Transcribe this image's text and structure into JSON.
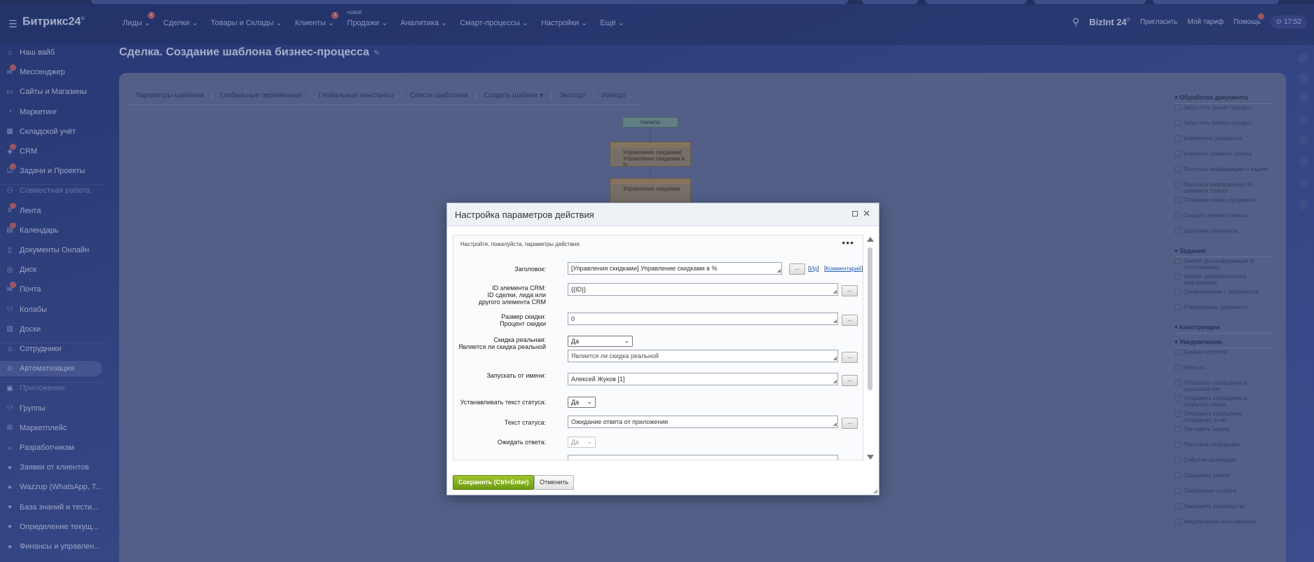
{
  "header": {
    "logo": "Битрикс24",
    "logo_sup": "®",
    "nav": [
      {
        "label": "Лиды",
        "badge": "1"
      },
      {
        "label": "Сделки",
        "badge": ""
      },
      {
        "label": "Товары и Склады",
        "badge": ""
      },
      {
        "label": "Клиенты",
        "badge": "1"
      },
      {
        "label": "Продажи",
        "badge": "",
        "tag": "НОВОЕ"
      },
      {
        "label": "Аналитика",
        "badge": ""
      },
      {
        "label": "Смарт-процессы",
        "badge": ""
      },
      {
        "label": "Настройки",
        "badge": ""
      },
      {
        "label": "Ещё",
        "badge": ""
      }
    ],
    "brand": "BizInt 24",
    "brand_sup": "®",
    "invite": "Пригласить",
    "tariff": "Мой тариф",
    "help": "Помощь",
    "time": "17:52"
  },
  "sidebar": {
    "items": [
      {
        "label": "Наш вайб",
        "icon": "home-icon",
        "badge": false
      },
      {
        "label": "Мессенджер",
        "icon": "chat-icon",
        "badge": true
      },
      {
        "label": "Сайты и Магазины",
        "icon": "site-icon",
        "badge": false
      },
      {
        "label": "Маркетинг",
        "icon": "marketing-icon",
        "badge": false
      },
      {
        "label": "Складской учёт",
        "icon": "warehouse-icon",
        "badge": false
      },
      {
        "label": "CRM",
        "icon": "crm-icon",
        "badge": true
      },
      {
        "label": "Задачи и Проекты",
        "icon": "tasks-icon",
        "badge": true
      },
      {
        "label": "Совместная работа",
        "icon": "collab-icon",
        "badge": false
      },
      {
        "label": "Лента",
        "icon": "feed-icon",
        "badge": true
      },
      {
        "label": "Календарь",
        "icon": "calendar-icon",
        "badge": true
      },
      {
        "label": "Документы Онлайн",
        "icon": "docs-icon",
        "badge": false
      },
      {
        "label": "Диск",
        "icon": "disk-icon",
        "badge": false
      },
      {
        "label": "Почта",
        "icon": "mail-icon",
        "badge": true
      },
      {
        "label": "Колабы",
        "icon": "collabs-icon",
        "badge": false
      },
      {
        "label": "Доски",
        "icon": "boards-icon",
        "badge": false
      },
      {
        "label": "Сотрудники",
        "icon": "employees-icon",
        "badge": false
      },
      {
        "label": "Автоматизация",
        "icon": "automation-icon",
        "badge": false
      },
      {
        "label": "Приложения",
        "icon": "apps-icon",
        "badge": false
      },
      {
        "label": "Группы",
        "icon": "groups-icon",
        "badge": false
      },
      {
        "label": "Маркетплейс",
        "icon": "market-icon",
        "badge": false
      },
      {
        "label": "Разработчикам",
        "icon": "dev-icon",
        "badge": false
      },
      {
        "label": "Заявки от клиентов",
        "icon": "app-icon",
        "badge": false
      },
      {
        "label": "Wazzup (WhatsApp, T...",
        "icon": "app-icon",
        "badge": false
      },
      {
        "label": "База знаний и тести...",
        "icon": "app-icon",
        "badge": false
      },
      {
        "label": "Определение текущ...",
        "icon": "app-icon",
        "badge": false
      },
      {
        "label": "Финансы и управлен...",
        "icon": "app-icon",
        "badge": false
      }
    ]
  },
  "page": {
    "title": "Сделка. Создание шаблона бизнес-процесса",
    "tabs": [
      "Параметры шаблона",
      "Глобальные переменные",
      "Глобальные константы",
      "Список шаблонов",
      "Создать шаблон ▾",
      "Экспорт",
      "Импорт"
    ],
    "workflow": {
      "start": "Начало",
      "box1": "Управление скидками] Управление скидками в %",
      "box2": "Управление скидками"
    }
  },
  "activities": {
    "sections": [
      {
        "title": "Обработка документа",
        "items": [
          "Запустить только процесс",
          "Запустить бизнес-процесс",
          "Изменение документа",
          "Изменить элемент списка",
          "Получить информацию о задаче",
          "Получить информацию об элементе списка",
          "Создание нового документа",
          "Создать элемент списка",
          "Удаление документа"
        ]
      },
      {
        "title": "Задания",
        "items": [
          "Запрос доп.информации (с отклонением)",
          "Запрос дополнительной информации",
          "Ознакомление с документом",
          "Утверждение документа"
        ]
      },
      {
        "title": "Конструкции",
        "items": []
      },
      {
        "title": "Уведомления",
        "items": [
          "График отпусков",
          "Новость",
          "Отправить сообщение в групповой чат",
          "Отправить сообщение в открытую линию",
          "Отправить сообщение сотруднику в чат",
          "Поставить задачу",
          "Почтовое сообщение",
          "Событие календаря",
          "Сохранить звонок",
          "Сообщение соцсети",
          "Уведомить руководство",
          "Уведомление пользователя"
        ]
      }
    ]
  },
  "dialog": {
    "title": "Настройка параметров действия",
    "hint": "Настройте, пожалуйста, параметры действия.",
    "more": "•••",
    "fields": {
      "title_label": "Заголовок:",
      "title_value": "[Управления скидками] Управление скидками в %",
      "title_link1": "Ид",
      "title_link2": "Комментарий",
      "crm_id_label": "ID элемента CRM:",
      "crm_id_sub": "ID сделки, лида или другого элемента CRM",
      "crm_id_value": "{{ID}}",
      "discount_label": "Размер скидки:",
      "discount_sub": "Процент скидки",
      "discount_value": "0",
      "real_label": "Скидка реальная:",
      "real_sub": "Является ли скидка реальной",
      "real_select": "Да",
      "real_placeholder": "Является ли скидка реальной",
      "run_as_label": "Запускать от имени:",
      "run_as_value": "Алексей Жуков [1]",
      "set_status_label": "Устанавливать текст статуса:",
      "set_status_select": "Да",
      "status_text_label": "Текст статуса:",
      "status_text_value": "Ожидание ответа от приложения",
      "wait_label": "Ожидать ответа:",
      "wait_select": "Да"
    },
    "ellipsis": "...",
    "save_label": "Сохранить (Ctrl+Enter)",
    "cancel_label": "Отменить"
  }
}
